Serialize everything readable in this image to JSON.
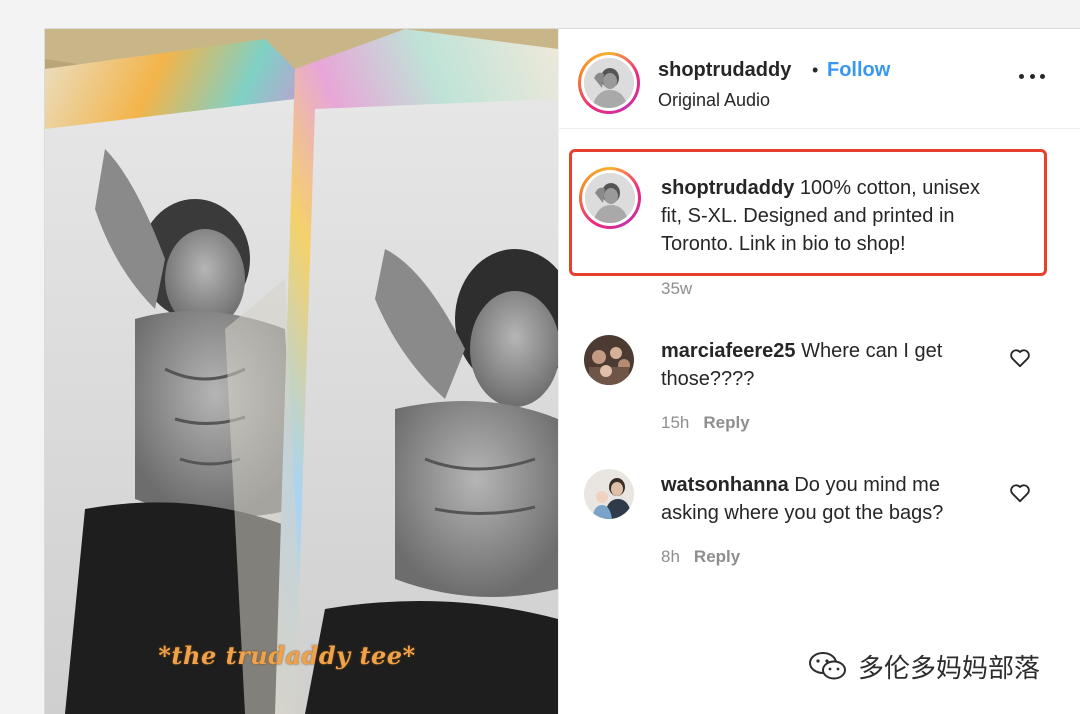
{
  "post": {
    "username": "shoptrudaddy",
    "separator": "•",
    "follow_label": "Follow",
    "audio_label": "Original Audio",
    "media_caption": "*the trudaddy tee*"
  },
  "caption": {
    "username": "shoptrudaddy",
    "line1": " 100% cotton, unisex",
    "line2": "fit, S-XL. Designed and printed in",
    "line3": "Toronto. Link in bio to shop!",
    "time": "35w"
  },
  "comments": [
    {
      "username": "marciafeere25",
      "line1": " Where can I get",
      "line2": "those????",
      "time": "15h",
      "reply_label": "Reply"
    },
    {
      "username": "watsonhanna",
      "line1": " Do you mind me",
      "line2": "asking where you got the bags?",
      "time": "8h",
      "reply_label": "Reply"
    }
  ],
  "watermark": {
    "text": "多伦多妈妈部落"
  },
  "icons": {
    "more": "more-options-icon",
    "like": "heart-icon",
    "watermark_logo": "wechat-icon"
  },
  "colors": {
    "link": "#3897f0",
    "highlight": "#e8402e",
    "muted": "#8e8e8e",
    "caption_overlay": "#f0a24a"
  }
}
